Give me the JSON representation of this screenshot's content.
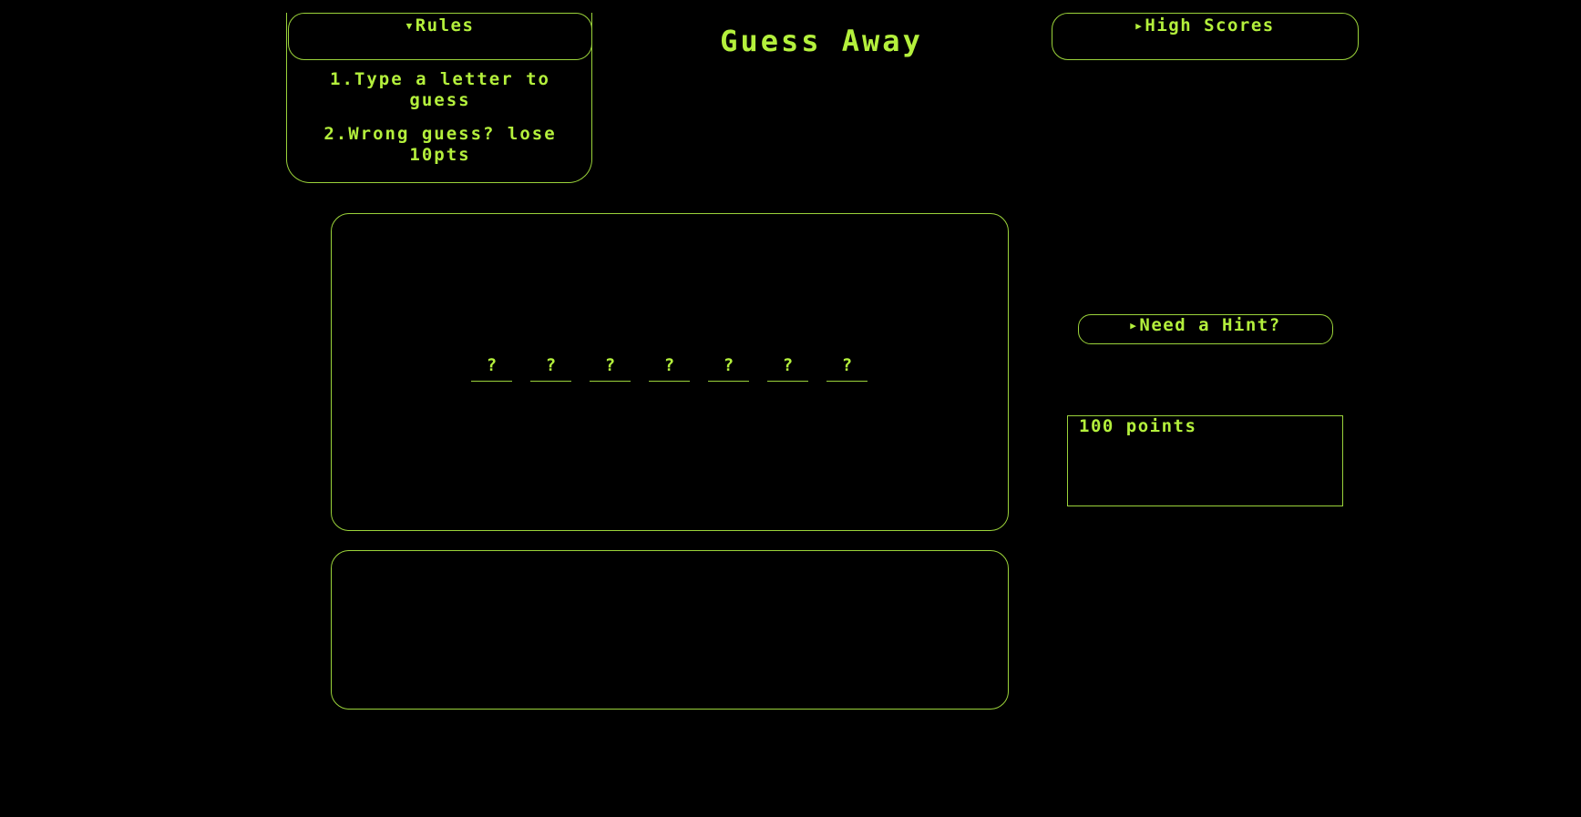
{
  "title": "Guess Away",
  "rules": {
    "summary": "Rules",
    "items": [
      "1.Type a letter to guess",
      "2.Wrong guess? lose 10pts"
    ]
  },
  "high_scores": {
    "summary": "High Scores"
  },
  "word": {
    "slots": [
      "?",
      "?",
      "?",
      "?",
      "?",
      "?",
      "?"
    ]
  },
  "hint": {
    "summary": "Need a Hint?"
  },
  "score": {
    "text": "100 points",
    "value": 100
  },
  "colors": {
    "accent": "#b4f03c",
    "background": "#000000"
  },
  "icons": {
    "expanded": "triangle-down-icon",
    "collapsed": "triangle-right-icon"
  }
}
